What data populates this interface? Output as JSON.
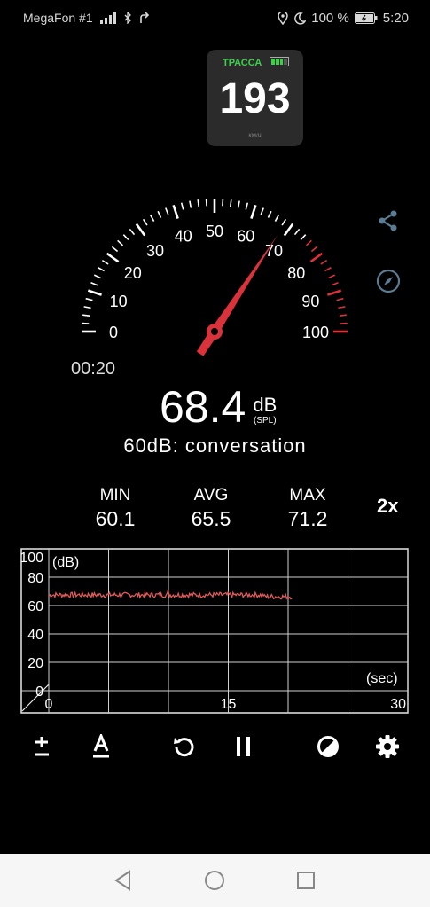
{
  "status_bar": {
    "carrier": "MegaFon #1",
    "battery": "100 %",
    "time": "5:20"
  },
  "widget": {
    "label": "ТРАССА",
    "value": "193",
    "unit": "КМ/Ч"
  },
  "gauge": {
    "ticks": [
      "0",
      "10",
      "20",
      "30",
      "40",
      "50",
      "60",
      "70",
      "80",
      "90",
      "100"
    ],
    "needle_value": 68.4,
    "red_zone_from": 75,
    "timer": "00:20"
  },
  "reading": {
    "value": "68.4",
    "unit": "dB",
    "unit_sub": "(SPL)",
    "description": "60dB: conversation"
  },
  "stats": {
    "min_label": "MIN",
    "min_value": "60.1",
    "avg_label": "AVG",
    "avg_value": "65.5",
    "max_label": "MAX",
    "max_value": "71.2",
    "zoom": "2x"
  },
  "graph": {
    "y_ticks": [
      "100",
      "80",
      "60",
      "40",
      "20",
      "0"
    ],
    "y_unit": "(dB)",
    "x_ticks": [
      "0",
      "15",
      "30"
    ],
    "x_unit": "(sec)",
    "line_color": "#e05a5a"
  },
  "toolbar": {
    "icons": [
      "plus-minus-icon",
      "font-icon",
      "reset-icon",
      "pause-icon",
      "theme-contrast-icon",
      "settings-gear-icon"
    ]
  },
  "colors": {
    "background": "#000000",
    "needle": "#d9323a",
    "red_zone": "#e0303a",
    "graph_line": "#e05a5a",
    "widget_green": "#3bd14b"
  }
}
